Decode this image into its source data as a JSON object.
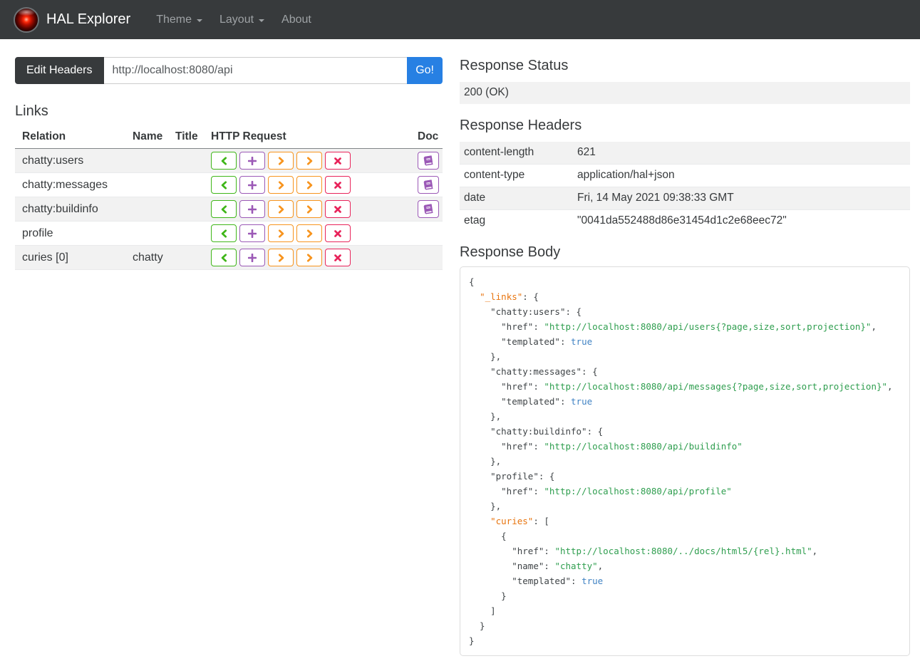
{
  "colors": {
    "primary": "#2780e3",
    "navbar_bg": "#373a3c",
    "get_green": "#3fb618",
    "post_purple": "#9b59b6",
    "put_patch_orange": "#f7941e",
    "delete_red": "#e8235a",
    "doc_purple": "#9b59b6",
    "stripe_gray": "#f2f2f2"
  },
  "navbar": {
    "brand": "HAL Explorer",
    "logo": "hal-9000-eye-icon",
    "items": [
      {
        "label": "Theme",
        "caret": true
      },
      {
        "label": "Layout",
        "caret": true
      },
      {
        "label": "About",
        "caret": false
      }
    ]
  },
  "request_bar": {
    "edit_headers_label": "Edit Headers",
    "url_value": "http://localhost:8080/api",
    "go_label": "Go!"
  },
  "links_section": {
    "title": "Links",
    "columns": [
      "Relation",
      "Name",
      "Title",
      "HTTP Request",
      "Doc"
    ],
    "http_buttons": [
      {
        "name": "get-button",
        "icon": "chevron-left-icon",
        "color": "#3fb618"
      },
      {
        "name": "post-button",
        "icon": "plus-icon",
        "color": "#9b59b6"
      },
      {
        "name": "put-button",
        "icon": "chevron-right-icon",
        "color": "#f7941e"
      },
      {
        "name": "patch-button",
        "icon": "chevron-right-icon",
        "color": "#f7941e"
      },
      {
        "name": "delete-button",
        "icon": "x-icon",
        "color": "#e8235a"
      }
    ],
    "doc_button": {
      "name": "doc-button",
      "icon": "book-icon",
      "color": "#9b59b6"
    },
    "rows": [
      {
        "relation": "chatty:users",
        "name": "",
        "title": "",
        "doc": true
      },
      {
        "relation": "chatty:messages",
        "name": "",
        "title": "",
        "doc": true
      },
      {
        "relation": "chatty:buildinfo",
        "name": "",
        "title": "",
        "doc": true
      },
      {
        "relation": "profile",
        "name": "",
        "title": "",
        "doc": false
      },
      {
        "relation": "curies [0]",
        "name": "chatty",
        "title": "",
        "doc": false
      }
    ]
  },
  "response_status": {
    "title": "Response Status",
    "value": "200 (OK)"
  },
  "response_headers": {
    "title": "Response Headers",
    "rows": [
      {
        "key": "content-length",
        "value": "621"
      },
      {
        "key": "content-type",
        "value": "application/hal+json"
      },
      {
        "key": "date",
        "value": "Fri, 14 May 2021 09:38:33 GMT"
      },
      {
        "key": "etag",
        "value": "\"0041da552488d86e31454d1c2e68eec72\""
      }
    ]
  },
  "response_body": {
    "title": "Response Body",
    "lines": [
      [
        [
          "p",
          "{"
        ]
      ],
      [
        [
          "p",
          "  "
        ],
        [
          "k",
          "\"_links\""
        ],
        [
          "p",
          ": {"
        ]
      ],
      [
        [
          "p",
          "    "
        ],
        [
          "a",
          "\"chatty:users\""
        ],
        [
          "p",
          ": {"
        ]
      ],
      [
        [
          "p",
          "      "
        ],
        [
          "a",
          "\"href\""
        ],
        [
          "p",
          ": "
        ],
        [
          "s",
          "\"http://localhost:8080/api/users{?page,size,sort,projection}\""
        ],
        [
          "p",
          ","
        ]
      ],
      [
        [
          "p",
          "      "
        ],
        [
          "a",
          "\"templated\""
        ],
        [
          "p",
          ": "
        ],
        [
          "l",
          "true"
        ]
      ],
      [
        [
          "p",
          "    },"
        ]
      ],
      [
        [
          "p",
          "    "
        ],
        [
          "a",
          "\"chatty:messages\""
        ],
        [
          "p",
          ": {"
        ]
      ],
      [
        [
          "p",
          "      "
        ],
        [
          "a",
          "\"href\""
        ],
        [
          "p",
          ": "
        ],
        [
          "s",
          "\"http://localhost:8080/api/messages{?page,size,sort,projection}\""
        ],
        [
          "p",
          ","
        ]
      ],
      [
        [
          "p",
          "      "
        ],
        [
          "a",
          "\"templated\""
        ],
        [
          "p",
          ": "
        ],
        [
          "l",
          "true"
        ]
      ],
      [
        [
          "p",
          "    },"
        ]
      ],
      [
        [
          "p",
          "    "
        ],
        [
          "a",
          "\"chatty:buildinfo\""
        ],
        [
          "p",
          ": {"
        ]
      ],
      [
        [
          "p",
          "      "
        ],
        [
          "a",
          "\"href\""
        ],
        [
          "p",
          ": "
        ],
        [
          "s",
          "\"http://localhost:8080/api/buildinfo\""
        ]
      ],
      [
        [
          "p",
          "    },"
        ]
      ],
      [
        [
          "p",
          "    "
        ],
        [
          "a",
          "\"profile\""
        ],
        [
          "p",
          ": {"
        ]
      ],
      [
        [
          "p",
          "      "
        ],
        [
          "a",
          "\"href\""
        ],
        [
          "p",
          ": "
        ],
        [
          "s",
          "\"http://localhost:8080/api/profile\""
        ]
      ],
      [
        [
          "p",
          "    },"
        ]
      ],
      [
        [
          "p",
          "    "
        ],
        [
          "k",
          "\"curies\""
        ],
        [
          "p",
          ": ["
        ]
      ],
      [
        [
          "p",
          "      {"
        ]
      ],
      [
        [
          "p",
          "        "
        ],
        [
          "a",
          "\"href\""
        ],
        [
          "p",
          ": "
        ],
        [
          "s",
          "\"http://localhost:8080/../docs/html5/{rel}.html\""
        ],
        [
          "p",
          ","
        ]
      ],
      [
        [
          "p",
          "        "
        ],
        [
          "a",
          "\"name\""
        ],
        [
          "p",
          ": "
        ],
        [
          "s",
          "\"chatty\""
        ],
        [
          "p",
          ","
        ]
      ],
      [
        [
          "p",
          "        "
        ],
        [
          "a",
          "\"templated\""
        ],
        [
          "p",
          ": "
        ],
        [
          "l",
          "true"
        ]
      ],
      [
        [
          "p",
          "      }"
        ]
      ],
      [
        [
          "p",
          "    ]"
        ]
      ],
      [
        [
          "p",
          "  }"
        ]
      ],
      [
        [
          "p",
          "}"
        ]
      ]
    ]
  }
}
